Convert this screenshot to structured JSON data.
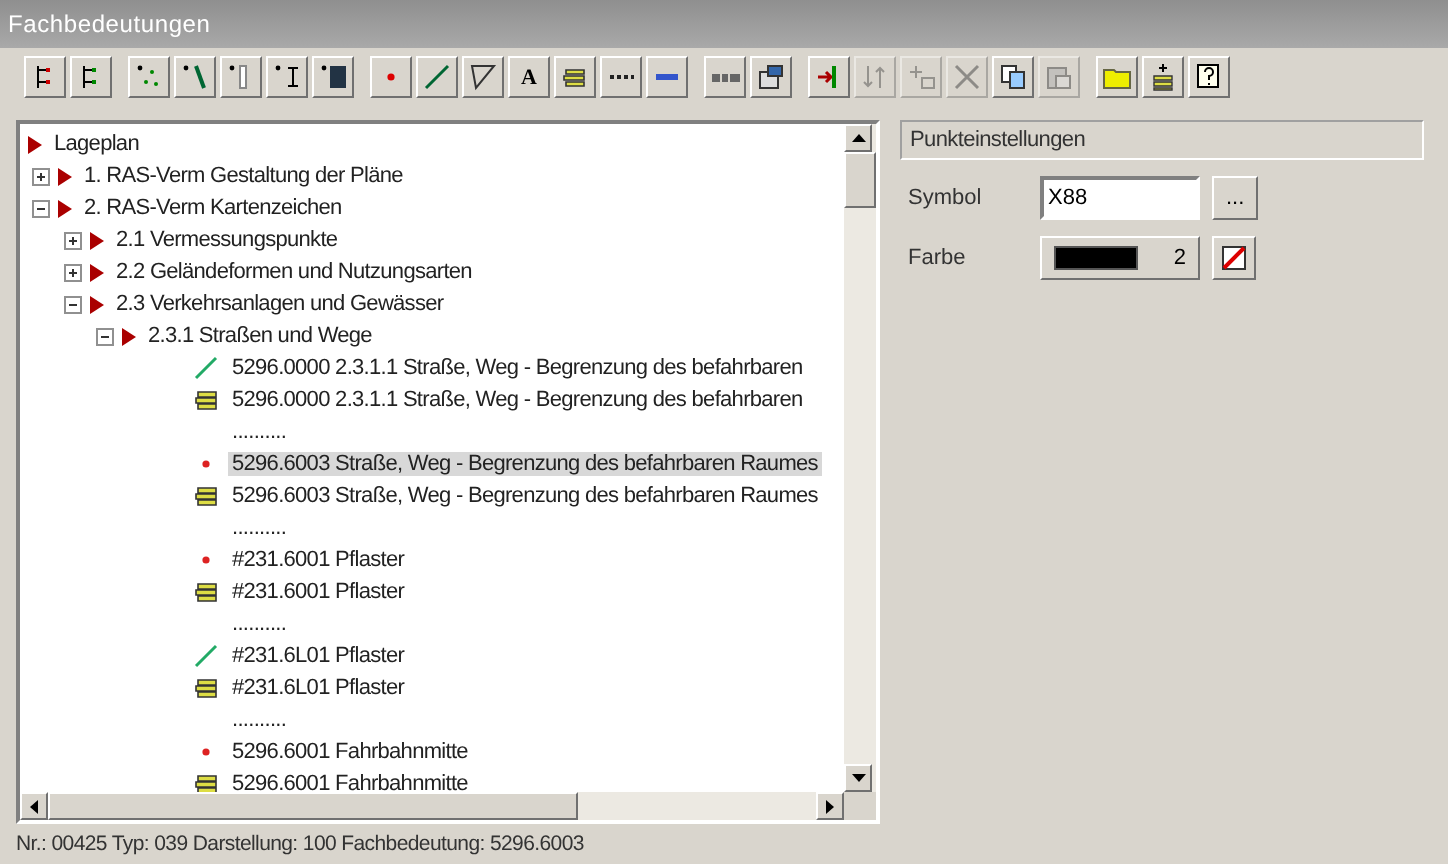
{
  "window": {
    "title": "Fachbedeutungen"
  },
  "toolbar": [
    {
      "buttons": [
        {
          "kind": "tree-a",
          "disabled": false
        },
        {
          "kind": "tree-b",
          "disabled": false
        }
      ]
    },
    {
      "buttons": [
        {
          "kind": "scatter",
          "disabled": false
        },
        {
          "kind": "slash",
          "disabled": false
        },
        {
          "kind": "bar",
          "disabled": false
        },
        {
          "kind": "text-cursor",
          "disabled": false
        },
        {
          "kind": "block",
          "disabled": false
        }
      ]
    },
    {
      "buttons": [
        {
          "kind": "point",
          "disabled": false
        },
        {
          "kind": "line",
          "disabled": false
        },
        {
          "kind": "area",
          "disabled": false
        },
        {
          "kind": "letter",
          "label": "A",
          "disabled": false
        },
        {
          "kind": "stack",
          "disabled": false
        },
        {
          "kind": "dots",
          "disabled": false
        },
        {
          "kind": "dash",
          "disabled": false
        }
      ]
    },
    {
      "buttons": [
        {
          "kind": "grid",
          "disabled": false
        },
        {
          "kind": "props",
          "disabled": false
        }
      ]
    },
    {
      "buttons": [
        {
          "kind": "insert",
          "disabled": false
        },
        {
          "kind": "move",
          "disabled": true
        },
        {
          "kind": "add",
          "disabled": true
        },
        {
          "kind": "cut",
          "disabled": true
        },
        {
          "kind": "copy",
          "disabled": false
        },
        {
          "kind": "paste",
          "disabled": true
        }
      ]
    },
    {
      "buttons": [
        {
          "kind": "folder",
          "disabled": false
        },
        {
          "kind": "layers",
          "disabled": false
        },
        {
          "kind": "help",
          "disabled": false
        }
      ]
    }
  ],
  "tree": [
    {
      "label": "Lageplan",
      "children": [
        {
          "label": "1. RAS-Verm Gestaltung der Pläne",
          "expanded": false
        },
        {
          "label": "2. RAS-Verm Kartenzeichen",
          "expanded": true,
          "children": [
            {
              "label": "2.1 Vermessungspunkte",
              "expanded": false
            },
            {
              "label": "2.2 Geländeformen und Nutzungsarten",
              "expanded": false
            },
            {
              "label": "2.3 Verkehrsanlagen und Gewässer",
              "expanded": true,
              "children": [
                {
                  "label": "2.3.1 Straßen und Wege",
                  "expanded": true,
                  "children": [
                    {
                      "kind": "line",
                      "label": "5296.0000 2.3.1.1 Straße, Weg - Begrenzung des befahrbaren",
                      "selected": false
                    },
                    {
                      "kind": "area",
                      "label": "5296.0000 2.3.1.1 Straße, Weg - Begrenzung des befahrbaren",
                      "selected": false
                    },
                    {
                      "kind": "separator",
                      "label": "..........",
                      "selected": false
                    },
                    {
                      "kind": "point",
                      "label": "5296.6003 Straße, Weg - Begrenzung des befahrbaren Raumes",
                      "selected": true
                    },
                    {
                      "kind": "area",
                      "label": "5296.6003 Straße, Weg - Begrenzung des befahrbaren Raumes",
                      "selected": false
                    },
                    {
                      "kind": "separator",
                      "label": "..........",
                      "selected": false
                    },
                    {
                      "kind": "point",
                      "label": "#231.6001 Pflaster",
                      "selected": false
                    },
                    {
                      "kind": "area",
                      "label": "#231.6001 Pflaster",
                      "selected": false
                    },
                    {
                      "kind": "separator",
                      "label": "..........",
                      "selected": false
                    },
                    {
                      "kind": "line",
                      "label": "#231.6L01 Pflaster",
                      "selected": false
                    },
                    {
                      "kind": "area",
                      "label": "#231.6L01 Pflaster",
                      "selected": false
                    },
                    {
                      "kind": "separator",
                      "label": "..........",
                      "selected": false
                    },
                    {
                      "kind": "point",
                      "label": "5296.6001 Fahrbahnmitte",
                      "selected": false
                    },
                    {
                      "kind": "area",
                      "label": "5296.6001 Fahrbahnmitte",
                      "selected": false
                    }
                  ]
                }
              ]
            }
          ]
        }
      ]
    }
  ],
  "status_bar": "Nr.: 00425 Typ: 039 Darstellung: 100 Fachbedeutung:  5296.6003",
  "settings": {
    "title": "Punkteinstellungen",
    "symbol_label": "Symbol",
    "symbol_value": "X88",
    "browse_button": "...",
    "color_label": "Farbe",
    "color": "#000000",
    "color_number": "2"
  }
}
